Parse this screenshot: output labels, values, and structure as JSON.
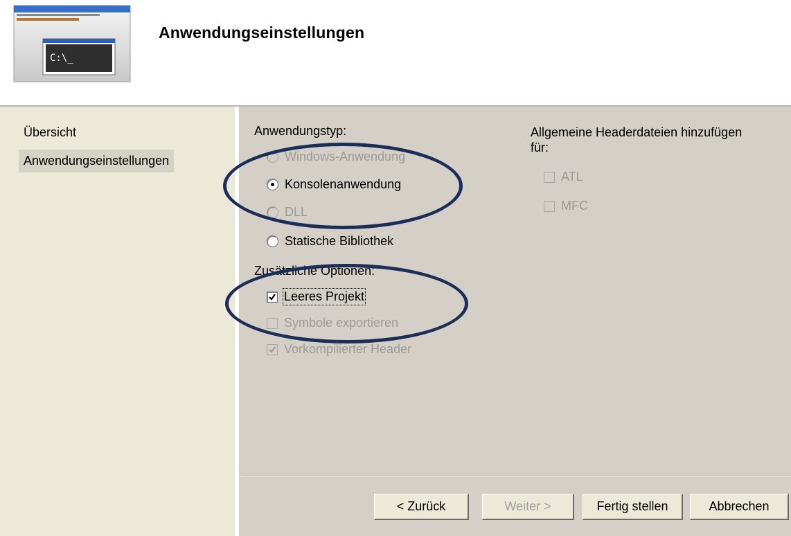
{
  "header": {
    "title": "Anwendungseinstellungen",
    "icon_prompt": "C:\\_"
  },
  "nav": {
    "items": [
      {
        "label": "Übersicht",
        "selected": false
      },
      {
        "label": "Anwendungseinstellungen",
        "selected": true
      }
    ]
  },
  "application_type": {
    "label": "Anwendungstyp:",
    "options": [
      {
        "label": "Windows-Anwendung",
        "checked": false,
        "enabled": false
      },
      {
        "label": "Konsolenanwendung",
        "checked": true,
        "enabled": true
      },
      {
        "label": "DLL",
        "checked": false,
        "enabled": false
      },
      {
        "label": "Statische Bibliothek",
        "checked": false,
        "enabled": true
      }
    ]
  },
  "additional_options": {
    "label": "Zusätzliche Optionen:",
    "options": [
      {
        "label": "Leeres Projekt",
        "checked": true,
        "enabled": true
      },
      {
        "label": "Symbole exportieren",
        "checked": false,
        "enabled": false
      },
      {
        "label": "Vorkompilierter Header",
        "checked": true,
        "enabled": false
      }
    ]
  },
  "common_headers": {
    "label_line1": "Allgemeine Headerdateien hinzufügen",
    "label_line2": "für:",
    "options": [
      {
        "label": "ATL",
        "checked": false,
        "enabled": false
      },
      {
        "label": "MFC",
        "checked": false,
        "enabled": false
      }
    ]
  },
  "buttons": {
    "back": "< Zurück",
    "next": "Weiter >",
    "finish": "Fertig stellen",
    "cancel": "Abbrechen"
  },
  "colors": {
    "annotation_ellipse": "#1c2e57",
    "dialog_face": "#d4d0c8",
    "nav_background": "#ece9d8"
  }
}
